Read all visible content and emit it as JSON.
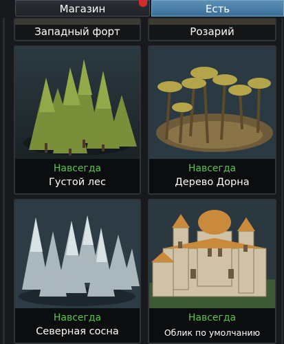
{
  "tabs": {
    "shop_label": "Магазин",
    "owned_label": "Есть"
  },
  "colors": {
    "accent_active_tab": "#4a7fa8",
    "status_green": "#58c44e",
    "notification": "#d22c2c"
  },
  "top_row": [
    {
      "name": "Западный форт"
    },
    {
      "name": "Розарий"
    }
  ],
  "cards": [
    {
      "status": "Навсегда",
      "name": "Густой лес",
      "icon": "dense-forest-icon"
    },
    {
      "status": "Навсегда",
      "name": "Дерево Дорна",
      "icon": "palm-tree-icon"
    },
    {
      "status": "Навсегда",
      "name": "Северная сосна",
      "icon": "snowy-pine-icon"
    },
    {
      "status": "Навсегда",
      "name": "Облик по умолчанию",
      "icon": "castle-icon"
    }
  ]
}
